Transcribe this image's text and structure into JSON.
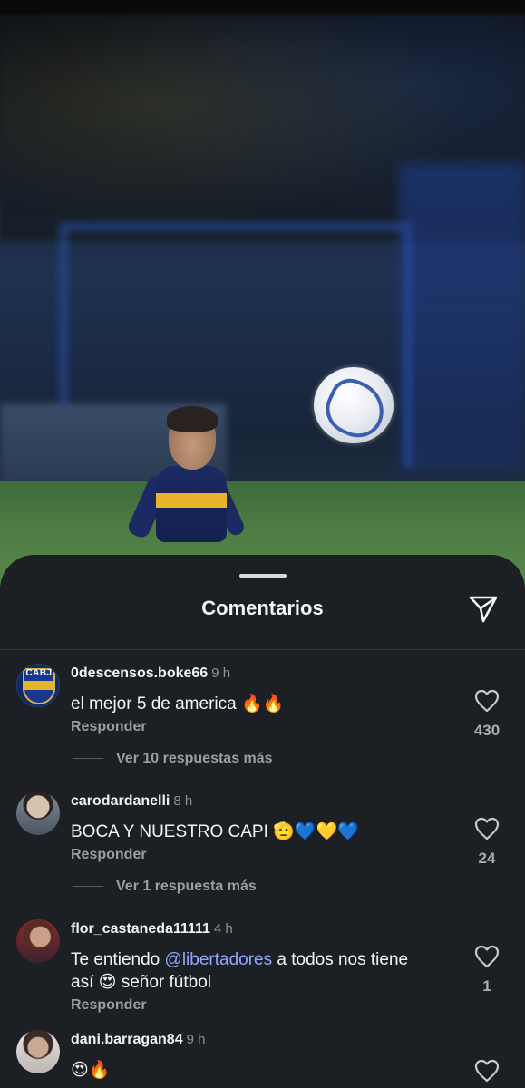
{
  "sheet": {
    "title": "Comentarios",
    "share_icon": "send-icon"
  },
  "comments": [
    {
      "avatar": "cabj-crest",
      "avatar_text": "CABJ",
      "username": "0descensos.boke66",
      "time": "9 h",
      "text": "el mejor 5 de america 🔥🔥",
      "reply": "Responder",
      "likes": "430",
      "view_replies": "Ver 10 respuestas más"
    },
    {
      "avatar": "user-photo",
      "username": "carodardanelli",
      "time": "8 h",
      "text": "BOCA Y NUESTRO CAPI 🫡💙💛💙",
      "reply": "Responder",
      "likes": "24",
      "view_replies": "Ver 1 respuesta más"
    },
    {
      "avatar": "user-photo",
      "username": "flor_castaneda11111",
      "time": "4 h",
      "text_before": "Te entiendo ",
      "mention": "@libertadores",
      "text_after": " a todos nos tiene así 😍 señor fútbol",
      "reply": "Responder",
      "likes": "1"
    },
    {
      "avatar": "user-photo",
      "username": "dani.barragan84",
      "time": "9 h",
      "text": "😍🔥"
    }
  ],
  "colors": {
    "sheet_bg": "#1c1f24",
    "text_primary": "#f5f5f5",
    "text_secondary": "#9a9da2",
    "mention": "#8fa8ff"
  }
}
